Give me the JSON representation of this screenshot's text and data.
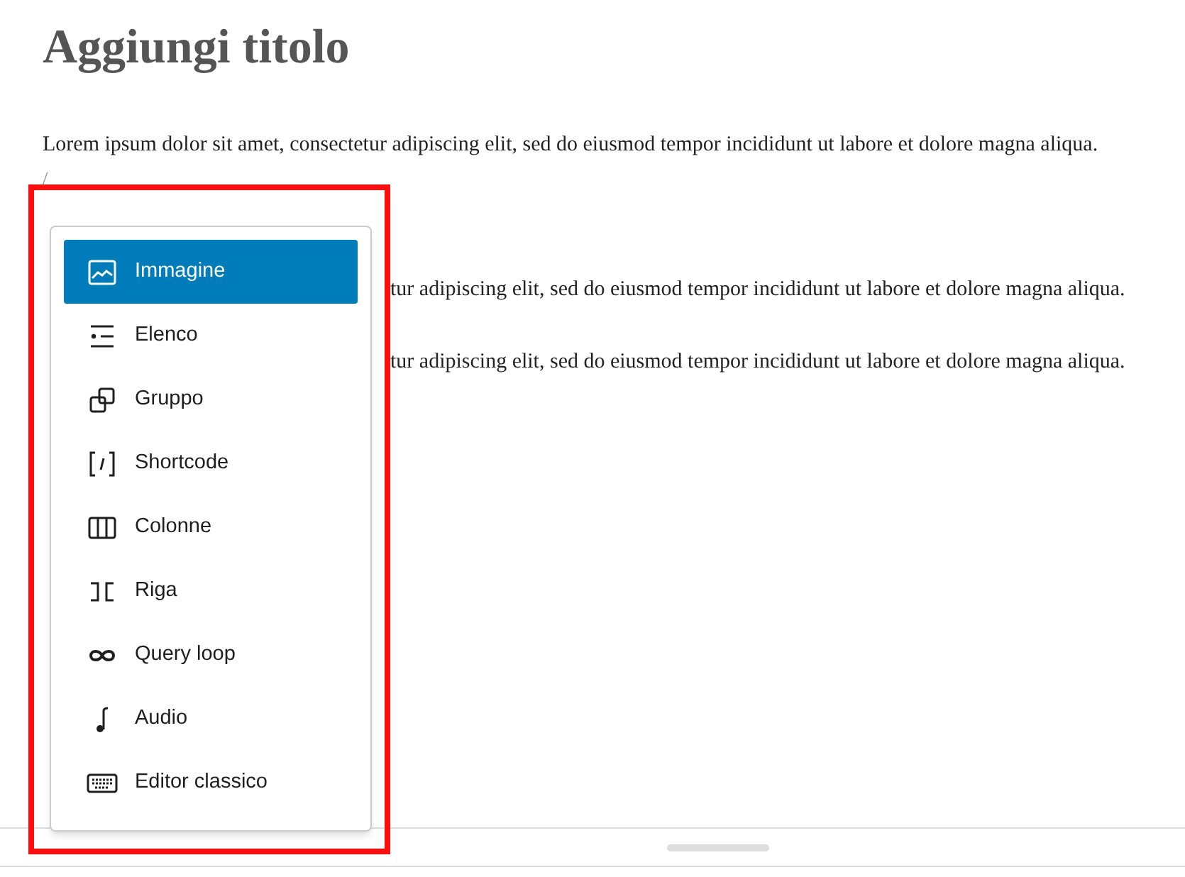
{
  "title": "Aggiungi titolo",
  "paragraphs": [
    {
      "text": "Lorem ipsum dolor sit amet, consectetur adipiscing elit, sed do eiusmod tempor incididunt ut labore et dolore magna aliqua."
    },
    {
      "text": "/",
      "kind": "slash"
    },
    {
      "text": "tur adipiscing elit, sed do eiusmod tempor incididunt ut labore et dolore magna aliqua.",
      "kind": "partial"
    },
    {
      "text": "tur adipiscing elit, sed do eiusmod tempor incididunt ut labore et dolore magna aliqua.",
      "kind": "partial"
    }
  ],
  "block_menu": {
    "items": [
      {
        "label": "Immagine",
        "kind": "image",
        "selected": true
      },
      {
        "label": "Elenco",
        "kind": "list",
        "selected": false
      },
      {
        "label": "Gruppo",
        "kind": "group",
        "selected": false
      },
      {
        "label": "Shortcode",
        "kind": "shortcode",
        "selected": false
      },
      {
        "label": "Colonne",
        "kind": "columns",
        "selected": false
      },
      {
        "label": "Riga",
        "kind": "row",
        "selected": false
      },
      {
        "label": "Query loop",
        "kind": "loop",
        "selected": false
      },
      {
        "label": "Audio",
        "kind": "audio",
        "selected": false
      },
      {
        "label": "Editor classico",
        "kind": "keyboard",
        "selected": false
      }
    ]
  }
}
